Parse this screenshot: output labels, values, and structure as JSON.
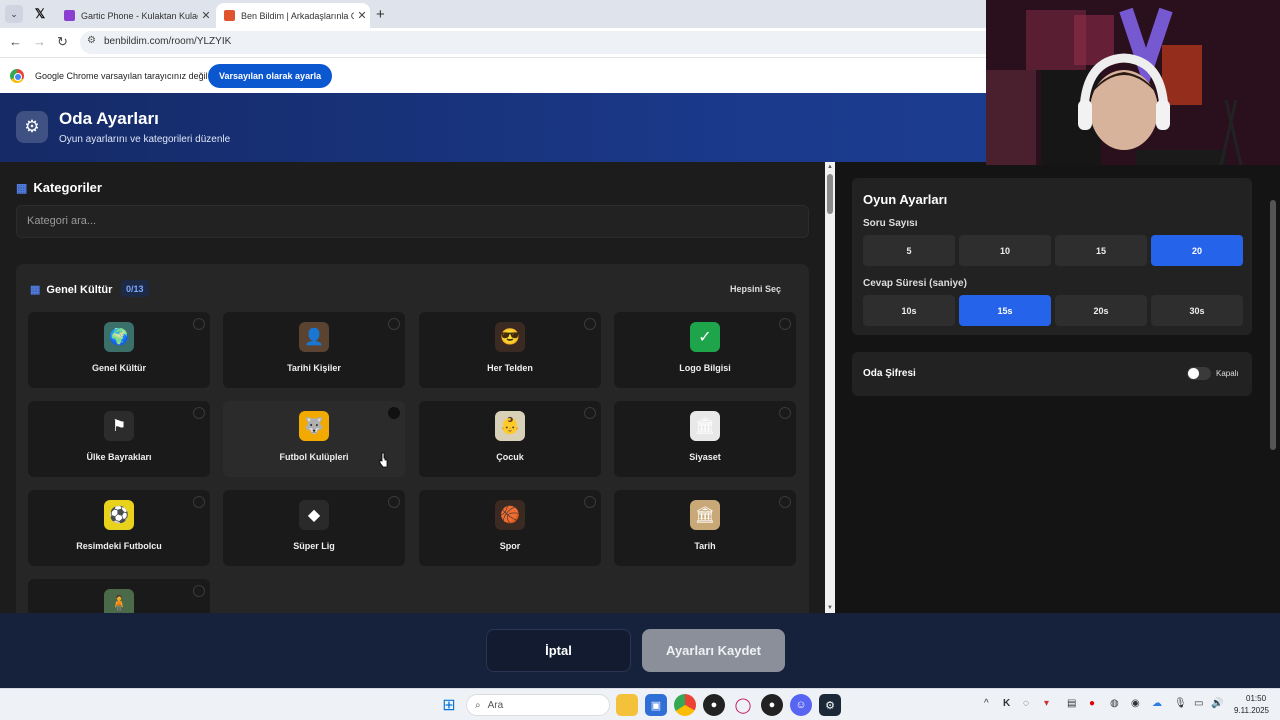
{
  "browser": {
    "tabs": [
      {
        "title": "Gartic Phone - Kulaktan Kulağa",
        "favicon_color": "#8b3fd1"
      },
      {
        "title": "Ben Bildim | Arkadaşlarınla Onli",
        "favicon_color": "#e0532f"
      }
    ],
    "url": "benbildim.com/room/YLZYIK",
    "infobar_text": "Google Chrome varsayılan tarayıcınız değil",
    "infobar_button": "Varsayılan olarak ayarla"
  },
  "header": {
    "title": "Oda Ayarları",
    "subtitle": "Oyun ayarlarını ve kategorileri düzenle"
  },
  "categories": {
    "heading": "Kategoriler",
    "search_placeholder": "Kategori ara...",
    "section_title": "Genel Kültür",
    "section_count": "0/13",
    "select_all": "Hepsini Seç",
    "items": [
      {
        "label": "Genel Kültür",
        "icon": "globe-character-icon",
        "glyph": "🌍",
        "bg": "#3a6f6a"
      },
      {
        "label": "Tarihi Kişiler",
        "icon": "portrait-icon",
        "glyph": "👤",
        "bg": "#5a4330"
      },
      {
        "label": "Her Telden",
        "icon": "sunglasses-face-icon",
        "glyph": "😎",
        "bg": "#3a2a22"
      },
      {
        "label": "Logo Bilgisi",
        "icon": "logo-icon",
        "glyph": "✓",
        "bg": "#1ea44a"
      },
      {
        "label": "Ülke Bayrakları",
        "icon": "flag-icon",
        "glyph": "⚑",
        "bg": "#2c2c2c"
      },
      {
        "label": "Futbol Kulüpleri",
        "icon": "wolf-crest-icon",
        "glyph": "🐺",
        "bg": "#f2a900"
      },
      {
        "label": "Çocuk",
        "icon": "child-icon",
        "glyph": "👶",
        "bg": "#d9d0b8"
      },
      {
        "label": "Siyaset",
        "icon": "parliament-icon",
        "glyph": "🏛",
        "bg": "#e8e8e8"
      },
      {
        "label": "Resimdeki Futbolcu",
        "icon": "footballer-icon",
        "glyph": "⚽",
        "bg": "#e9d21b"
      },
      {
        "label": "Süper Lig",
        "icon": "league-logo-icon",
        "glyph": "◆",
        "bg": "#2a2a2a"
      },
      {
        "label": "Spor",
        "icon": "sports-balls-icon",
        "glyph": "🏀",
        "bg": "#3a2a22"
      },
      {
        "label": "Tarih",
        "icon": "colosseum-icon",
        "glyph": "🏛",
        "bg": "#c9a877"
      },
      {
        "label": "",
        "icon": "figure-icon",
        "glyph": "🧍",
        "bg": "#4a6a4a"
      }
    ]
  },
  "game_settings": {
    "title": "Oyun Ayarları",
    "question_count_label": "Soru Sayısı",
    "question_count_options": [
      "5",
      "10",
      "15",
      "20"
    ],
    "question_count_selected": "20",
    "answer_time_label": "Cevap Süresi (saniye)",
    "answer_time_options": [
      "10s",
      "15s",
      "20s",
      "30s"
    ],
    "answer_time_selected": "15s"
  },
  "room_password": {
    "label": "Oda Şifresi",
    "state": "Kapalı",
    "enabled": false
  },
  "footer": {
    "cancel": "İptal",
    "save": "Ayarları Kaydet"
  },
  "taskbar": {
    "search_placeholder": "Ara",
    "time": "01:50",
    "date": "9.11.2025"
  },
  "colors": {
    "accent": "#2563eb",
    "header_bg": "#1b3a8c",
    "panel_bg": "#1c1c1c"
  }
}
